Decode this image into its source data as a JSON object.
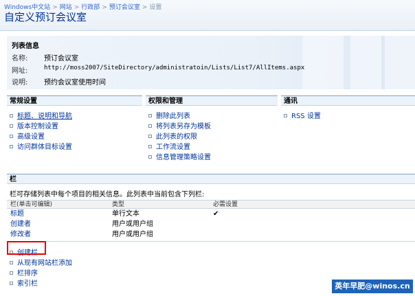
{
  "breadcrumb": [
    "Windows中文站",
    "网站",
    "行政部",
    "预订会议室",
    "设置"
  ],
  "page_title": "自定义预订会议室",
  "list_info": {
    "title": "列表信息",
    "name_label": "名称:",
    "name_value": "预订会议室",
    "url_label": "网址:",
    "url_value": "http://moss2007/SiteDirectory/administratoin/Lists/List7/AllItems.aspx",
    "desc_label": "说明:",
    "desc_value": "预约会议室使用时间"
  },
  "general_settings": {
    "title": "常规设置",
    "items": [
      "标题、说明和导航",
      "版本控制设置",
      "高级设置",
      "访问群体目标设置"
    ]
  },
  "permissions": {
    "title": "权限和管理",
    "items": [
      "删除此列表",
      "将列表另存为模板",
      "此列表的权限",
      "工作流设置",
      "信息管理策略设置"
    ]
  },
  "communications": {
    "title": "通讯",
    "items": [
      "RSS 设置"
    ]
  },
  "columns": {
    "title": "栏",
    "description": "栏可存储列表中每个项目的相关信息。此列表中当前包含下列栏:",
    "headers": [
      "栏(单击可编辑)",
      "类型",
      "必需设置"
    ],
    "rows": [
      {
        "name": "标题",
        "type": "单行文本",
        "required": "✔"
      },
      {
        "name": "创建者",
        "type": "用户或用户组",
        "required": ""
      },
      {
        "name": "修改者",
        "type": "用户或用户组",
        "required": ""
      }
    ],
    "actions": [
      "创建栏",
      "从现有网站栏添加",
      "栏排序",
      "索引栏"
    ]
  },
  "watermark": "英年早肥@winos.cn"
}
